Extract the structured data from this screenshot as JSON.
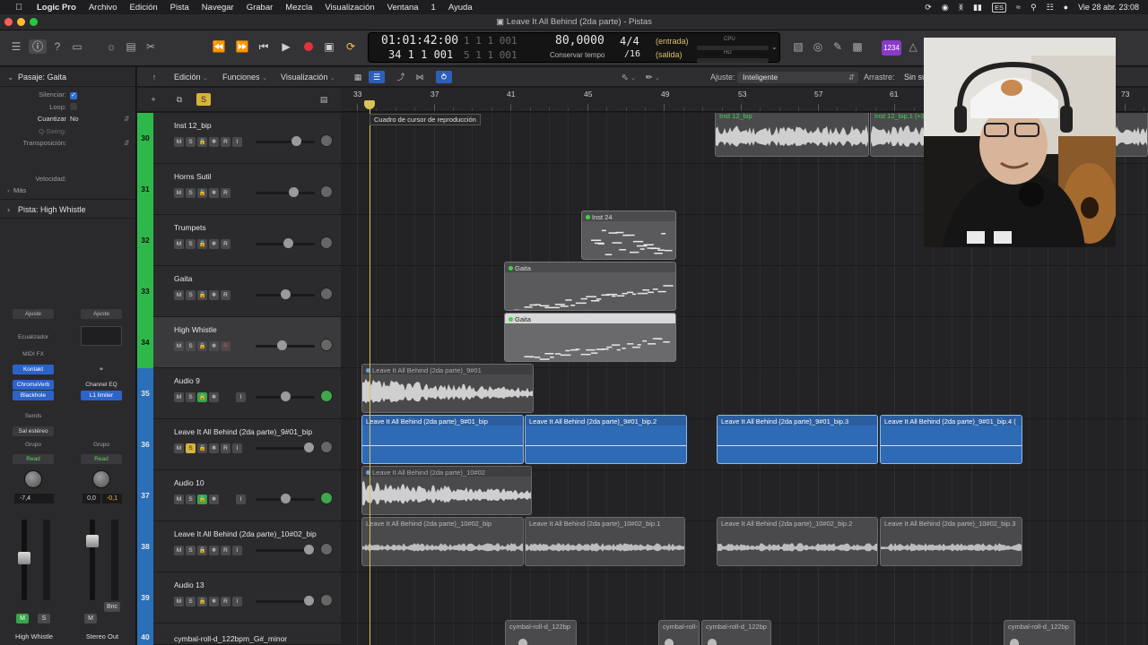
{
  "menubar": {
    "app": "Logic Pro",
    "items": [
      "Archivo",
      "Edición",
      "Pista",
      "Navegar",
      "Grabar",
      "Mezcla",
      "Visualización",
      "Ventana",
      "1",
      "Ayuda"
    ],
    "keyboard": "ES",
    "datetime": "Vie 28 abr.  23:08"
  },
  "window": {
    "title": "Leave It All Behind (2da parte) - Pistas"
  },
  "lcd": {
    "time": "01:01:42:00",
    "time_sub": "1  1  1  001",
    "bars": "34  1  1  001",
    "bars_sub": "5  1  1  001",
    "tempo": "80,0000",
    "tempo_label": "Conservar tempo",
    "sig_top": "4/4",
    "sig_bottom": "/16",
    "in_label": "(entrada)",
    "out_label": "(salida)",
    "cpu_label": "CPU",
    "hd_label": "HD"
  },
  "control_pill": "1234",
  "inspector": {
    "region_header": "Pasaje: Gaita",
    "rows": [
      {
        "label": "Silenciar:",
        "value": "✓"
      },
      {
        "label": "Loop:",
        "value": ""
      },
      {
        "label": "Cuantizar",
        "value": "No"
      },
      {
        "label": "Q-Swing:",
        "value": ""
      },
      {
        "label": "Transposición:",
        "value": ""
      },
      {
        "label": "Velocidad:",
        "value": ""
      }
    ],
    "more": "Más",
    "track_header": "Pista:  High Whistle"
  },
  "strip_left": {
    "ajuste": "Ajuste",
    "eq": "Ecualizador",
    "midifx": "MIDI FX",
    "instrument": "Kontakt",
    "fx1": "ChromaVerb",
    "fx2": "Blackhole",
    "sends": "Sends",
    "output": "Sal estéreo",
    "group": "Grupo",
    "automation": "Read",
    "vol": "-7,4",
    "name": "High Whistle",
    "m": "M",
    "s": "S"
  },
  "strip_right": {
    "ajuste": "Ajuste",
    "fx1": "Channel EQ",
    "fx2": "L1 limiter",
    "group": "Grupo",
    "automation": "Read",
    "vol": "0,0",
    "peak": "-0,1",
    "bnc": "Bnc",
    "name": "Stereo Out",
    "m": "M"
  },
  "toolbar": {
    "edicion": "Edición",
    "funciones": "Funciones",
    "visualizacion": "Visualización",
    "ajuste_label": "Ajuste:",
    "ajuste_value": "Inteligente",
    "arrastre_label": "Arrastre:",
    "arrastre_value": "Sin su"
  },
  "ruler": {
    "bars": [
      "33",
      "37",
      "41",
      "45",
      "49",
      "53",
      "57",
      "61",
      "73"
    ]
  },
  "tooltip": "Cuadro de cursor de reproducción",
  "tracks": [
    {
      "num": "30",
      "name": "Inst 12_bip",
      "color": "green",
      "type": "inst"
    },
    {
      "num": "31",
      "name": "Horns Sutil",
      "color": "green",
      "type": "inst"
    },
    {
      "num": "32",
      "name": "Trumpets",
      "color": "green",
      "type": "inst"
    },
    {
      "num": "33",
      "name": "Gaita",
      "color": "green",
      "type": "inst"
    },
    {
      "num": "34",
      "name": "High Whistle",
      "color": "green",
      "type": "inst",
      "selected": true
    },
    {
      "num": "35",
      "name": "Audio 9",
      "color": "blue",
      "type": "audio"
    },
    {
      "num": "36",
      "name": "Leave It All Behind (2da parte)_9#01_bip",
      "color": "blue",
      "type": "inst"
    },
    {
      "num": "37",
      "name": "Audio 10",
      "color": "blue",
      "type": "audio"
    },
    {
      "num": "38",
      "name": "Leave It All Behind (2da parte)_10#02_bip",
      "color": "blue",
      "type": "inst"
    },
    {
      "num": "39",
      "name": "Audio 13",
      "color": "blue",
      "type": "inst"
    },
    {
      "num": "40",
      "name": "cymbal-roll-d_122bpm_G#_minor",
      "color": "blue",
      "type": "inst"
    }
  ],
  "regions": {
    "inst12a": "Inst 12_bip",
    "inst12b": "Inst 12_bip.1 (+3",
    "inst24": "Inst 24",
    "gaita1": "Gaita",
    "gaita2": "Gaita",
    "audio9": "Leave It All Behind (2da parte)_9#01",
    "b1": "Leave It All Behind (2da parte)_9#01_bip",
    "b2": "Leave It All Behind (2da parte)_9#01_bip.2",
    "b3": "Leave It All Behind (2da parte)_9#01_bip.3",
    "b4": "Leave It All Behind (2da parte)_9#01_bip.4 (",
    "audio10": "Leave It All Behind (2da parte)_10#02",
    "g1": "Leave It All Behind (2da parte)_10#02_bip",
    "g2": "Leave It All Behind (2da parte)_10#02_bip.1",
    "g3": "Leave It All Behind (2da parte)_10#02_bip.2",
    "g4": "Leave It All Behind (2da parte)_10#02_bip.3",
    "cym1": "cymbal-roll-d_122bp",
    "cym2": "cymbal-roll-",
    "cym3": "cymbal-roll-d_122bp",
    "cym4": "cymbal-roll-d_122bp"
  }
}
